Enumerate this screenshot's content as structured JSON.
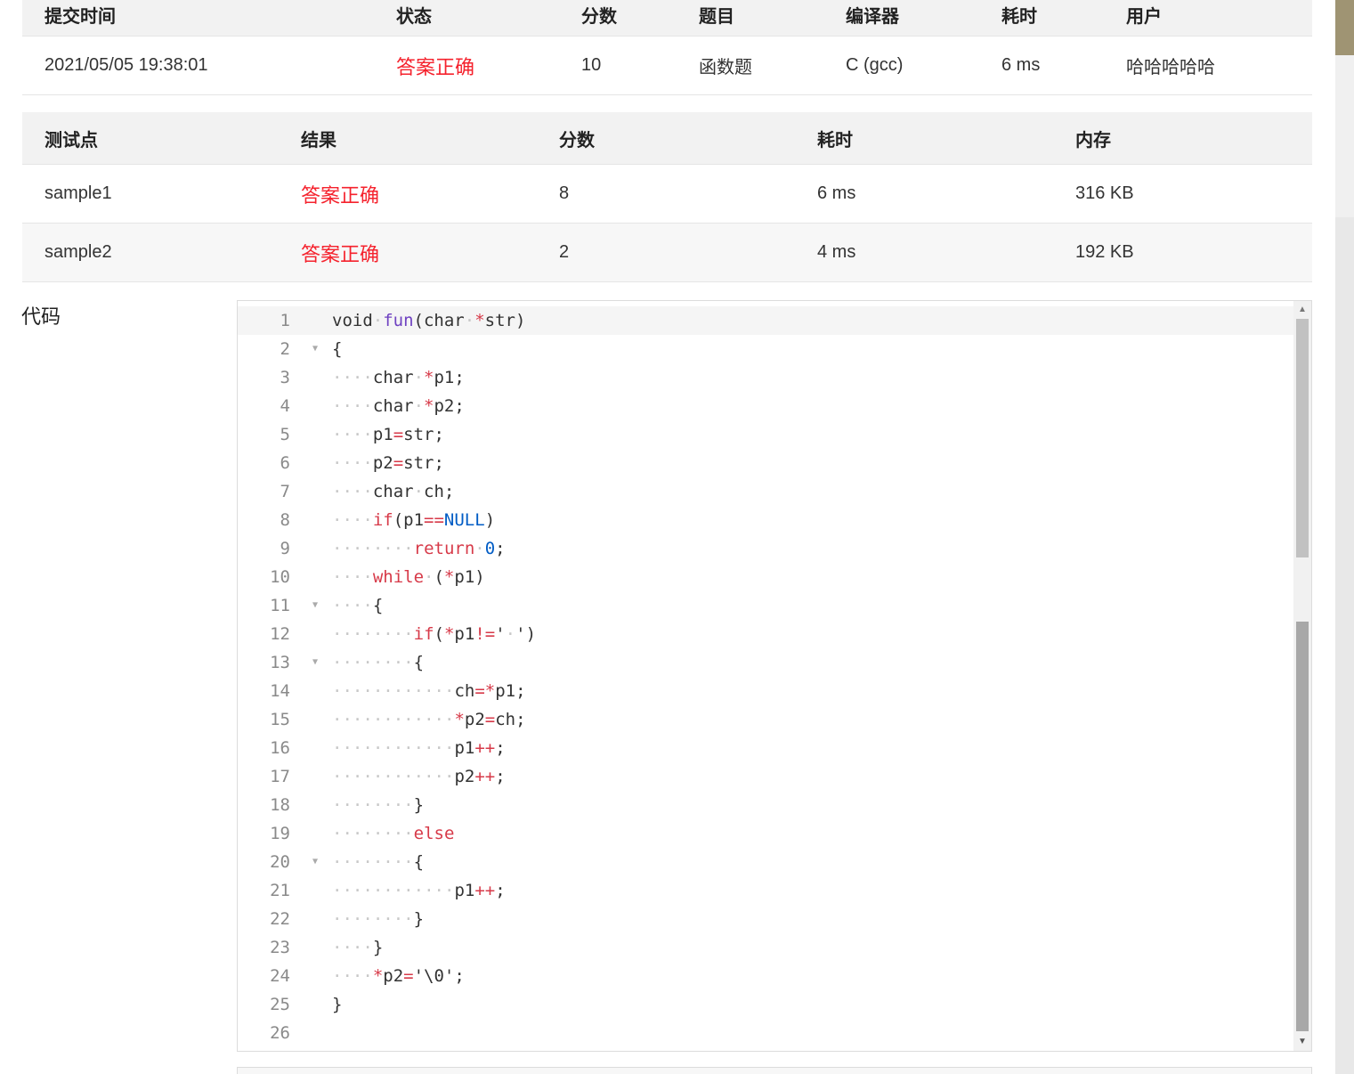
{
  "submission": {
    "headers": [
      "提交时间",
      "状态",
      "分数",
      "题目",
      "编译器",
      "耗时",
      "用户"
    ],
    "row": [
      "2021/05/05 19:38:01",
      "答案正确",
      "10",
      "函数题",
      "C (gcc)",
      "6 ms",
      "哈哈哈哈哈"
    ]
  },
  "testcases": {
    "headers": [
      "测试点",
      "结果",
      "分数",
      "耗时",
      "内存"
    ],
    "rows": [
      [
        "sample1",
        "答案正确",
        "8",
        "6 ms",
        "316 KB"
      ],
      [
        "sample2",
        "答案正确",
        "2",
        "4 ms",
        "192 KB"
      ]
    ]
  },
  "code": {
    "label": "代码",
    "lines": [
      "void fun(char *str)",
      "{",
      "    char *p1;",
      "    char *p2;",
      "    p1=str;",
      "    p2=str;",
      "    char ch;",
      "    if(p1==NULL)",
      "        return 0;",
      "    while (*p1)",
      "    {",
      "        if(*p1!=' ')",
      "        {",
      "            ch=*p1;",
      "            *p2=ch;",
      "            p1++;",
      "            p2++;",
      "        }",
      "        else",
      "        {",
      "            p1++;",
      "        }",
      "    }",
      "    *p2='\\0';",
      "}",
      ""
    ],
    "fold_lines": [
      2,
      11,
      13,
      20
    ]
  },
  "colors": {
    "status_red": "#f5222d",
    "header_bg": "#f2f2f2",
    "keyword": "#d73a49",
    "function": "#6f42c1",
    "constant": "#005cc5"
  }
}
